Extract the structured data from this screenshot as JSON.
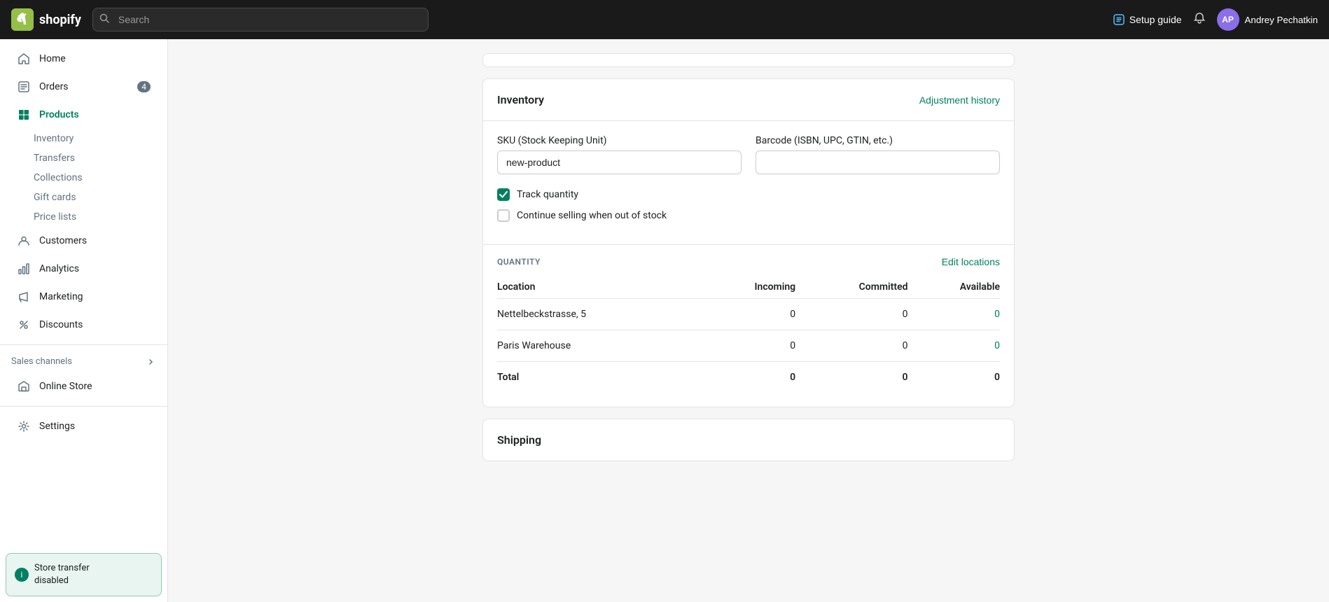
{
  "topbar": {
    "logo_text": "shopify",
    "search_placeholder": "Search",
    "setup_guide_label": "Setup guide",
    "bell_icon": "🔔",
    "user_initials": "AP",
    "user_name": "Andrey Pechatkin"
  },
  "sidebar": {
    "items": [
      {
        "id": "home",
        "label": "Home",
        "icon": "home",
        "active": false,
        "badge": null
      },
      {
        "id": "orders",
        "label": "Orders",
        "icon": "orders",
        "active": false,
        "badge": "4"
      },
      {
        "id": "products",
        "label": "Products",
        "icon": "products",
        "active": true,
        "badge": null
      },
      {
        "id": "customers",
        "label": "Customers",
        "icon": "customers",
        "active": false,
        "badge": null
      },
      {
        "id": "analytics",
        "label": "Analytics",
        "icon": "analytics",
        "active": false,
        "badge": null
      },
      {
        "id": "marketing",
        "label": "Marketing",
        "icon": "marketing",
        "active": false,
        "badge": null
      },
      {
        "id": "discounts",
        "label": "Discounts",
        "icon": "discounts",
        "active": false,
        "badge": null
      }
    ],
    "products_sub": [
      {
        "id": "inventory",
        "label": "Inventory"
      },
      {
        "id": "transfers",
        "label": "Transfers"
      },
      {
        "id": "collections",
        "label": "Collections"
      },
      {
        "id": "gift-cards",
        "label": "Gift cards"
      },
      {
        "id": "price-lists",
        "label": "Price lists"
      }
    ],
    "sales_channels_label": "Sales channels",
    "online_store_label": "Online Store",
    "settings_label": "Settings",
    "store_transfer_text": "Store transfer\ndisabled"
  },
  "inventory_card": {
    "title": "Inventory",
    "adjustment_history_label": "Adjustment history",
    "sku_label": "SKU (Stock Keeping Unit)",
    "sku_value": "new-product",
    "barcode_label": "Barcode (ISBN, UPC, GTIN, etc.)",
    "barcode_value": "",
    "track_quantity_label": "Track quantity",
    "track_quantity_checked": true,
    "continue_selling_label": "Continue selling when out of stock",
    "continue_selling_checked": false,
    "quantity_section_label": "QUANTITY",
    "edit_locations_label": "Edit locations",
    "table": {
      "headers": [
        "Location",
        "Incoming",
        "Committed",
        "Available"
      ],
      "rows": [
        {
          "location": "Nettelbeckstrasse, 5",
          "incoming": "0",
          "committed": "0",
          "available": "0"
        },
        {
          "location": "Paris Warehouse",
          "incoming": "0",
          "committed": "0",
          "available": "0"
        }
      ],
      "total_row": {
        "label": "Total",
        "incoming": "0",
        "committed": "0",
        "available": "0"
      }
    }
  },
  "shipping_card": {
    "title": "Shipping"
  }
}
